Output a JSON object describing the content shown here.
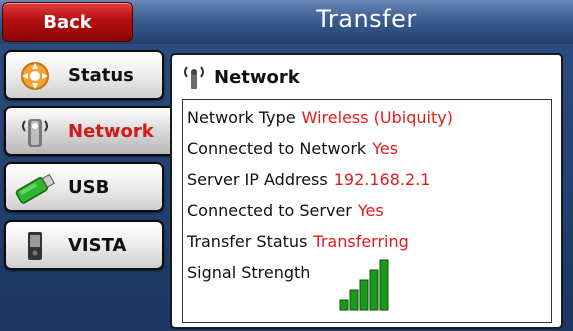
{
  "header": {
    "title": "Transfer",
    "back_label": "Back"
  },
  "nav": [
    {
      "label": "Status",
      "icon": "status-gear-icon",
      "active": false
    },
    {
      "label": "Network",
      "icon": "antenna-icon",
      "active": true
    },
    {
      "label": "USB",
      "icon": "usb-drive-icon",
      "active": false
    },
    {
      "label": "VISTA",
      "icon": "vista-device-icon",
      "active": false
    }
  ],
  "panel": {
    "title": "Network",
    "rows": [
      {
        "label": "Network Type",
        "value": "Wireless (Ubiquity)"
      },
      {
        "label": "Connected to Network",
        "value": "Yes"
      },
      {
        "label": "Server IP Address",
        "value": "192.168.2.1"
      },
      {
        "label": "Connected to Server",
        "value": "Yes"
      },
      {
        "label": "Transfer Status",
        "value": "Transferring"
      },
      {
        "label": "Signal Strength",
        "value": ""
      }
    ],
    "signal_level": 5,
    "signal_max": 5
  },
  "colors": {
    "accent": "#e21b1b",
    "header": "#3a5d92",
    "active_text": "#d31818"
  }
}
